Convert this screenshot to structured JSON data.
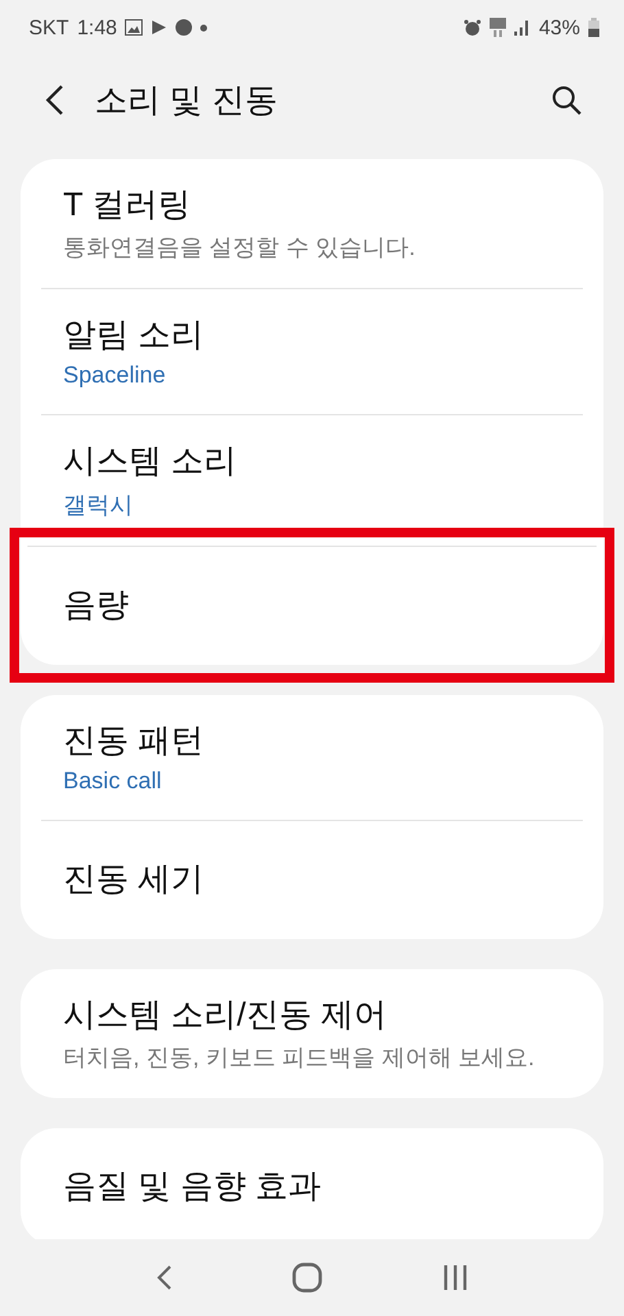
{
  "status_bar": {
    "carrier": "SKT",
    "time": "1:48",
    "battery": "43%"
  },
  "header": {
    "title": "소리 및 진동"
  },
  "groups": [
    {
      "items": [
        {
          "title": "T 컬러링",
          "summary": {
            "text": "통화연결음을 설정할 수 있습니다.",
            "kind": "description"
          },
          "highlighted": false
        },
        {
          "title": "알림 소리",
          "summary": {
            "text": "Spaceline",
            "kind": "value"
          },
          "highlighted": false
        },
        {
          "title": "시스템 소리",
          "summary": {
            "text": "갤럭시",
            "kind": "value"
          },
          "highlighted": false
        },
        {
          "title": "음량",
          "highlighted": true
        }
      ]
    },
    {
      "items": [
        {
          "title": "진동 패턴",
          "summary": {
            "text": "Basic call",
            "kind": "value"
          },
          "highlighted": false
        },
        {
          "title": "진동 세기",
          "highlighted": false
        }
      ]
    },
    {
      "items": [
        {
          "title": "시스템 소리/진동 제어",
          "summary": {
            "text": "터치음, 진동, 키보드 피드백을 제어해 보세요.",
            "kind": "description"
          },
          "highlighted": false
        }
      ]
    },
    {
      "items": [
        {
          "title": "음질 및 음향 효과",
          "highlighted": false
        }
      ]
    }
  ]
}
